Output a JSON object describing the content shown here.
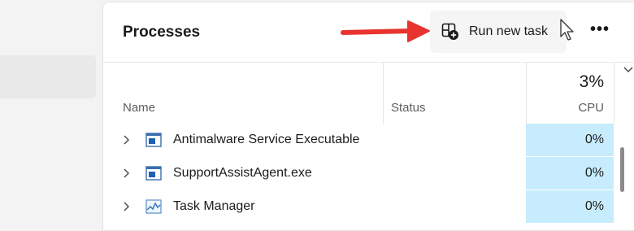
{
  "header": {
    "title": "Processes",
    "run_task_label": "Run new task",
    "more_label": "•••"
  },
  "table": {
    "columns": {
      "name": "Name",
      "status": "Status",
      "cpu": "CPU"
    },
    "cpu_total": "3%",
    "rows": [
      {
        "name": "Antimalware Service Executable",
        "status": "",
        "cpu": "0%",
        "icon": "app-window-icon"
      },
      {
        "name": "SupportAssistAgent.exe",
        "status": "",
        "cpu": "0%",
        "icon": "app-window-icon"
      },
      {
        "name": "Task Manager",
        "status": "",
        "cpu": "0%",
        "icon": "task-manager-icon"
      }
    ]
  },
  "colors": {
    "accent_arrow": "#e8342f",
    "cpu_highlight": "#c7ecfd",
    "panel_bg": "#ffffff",
    "window_bg": "#f3f3f3"
  }
}
